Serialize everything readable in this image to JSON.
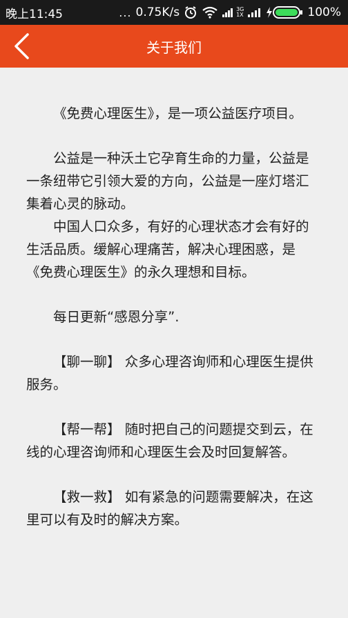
{
  "status_bar": {
    "time": "晚上11:45",
    "dots": "...",
    "speed": "0.75K/s",
    "network_small_top": "3G",
    "network_small_bottom": "1X",
    "battery": "100%"
  },
  "header": {
    "title": "关于我们"
  },
  "content": {
    "paragraphs": [
      "《免费心理医生》，是一项公益医疗项目。",
      "公益是一种沃土它孕育生命的力量，公益是一条纽带它引领大爱的方向，公益是一座灯塔汇集着心灵的脉动。",
      "中国人口众多，有好的心理状态才会有好的生活品质。缓解心理痛苦，解决心理困惑，是《免费心理医生》的永久理想和目标。",
      "每日更新“感恩分享”.",
      "【聊一聊】 众多心理咨询师和心理医生提供服务。",
      "【帮一帮】 随时把自己的问题提交到云，在线的心理咨询师和心理医生会及时回复解答。",
      "【救一救】 如有紧急的问题需要解决，在这里可以有及时的解决方案。"
    ]
  },
  "colors": {
    "header_bg": "#e8491c",
    "status_bg": "#1a1a1a",
    "page_bg": "#efefef",
    "battery_fill": "#3ddc5a"
  }
}
